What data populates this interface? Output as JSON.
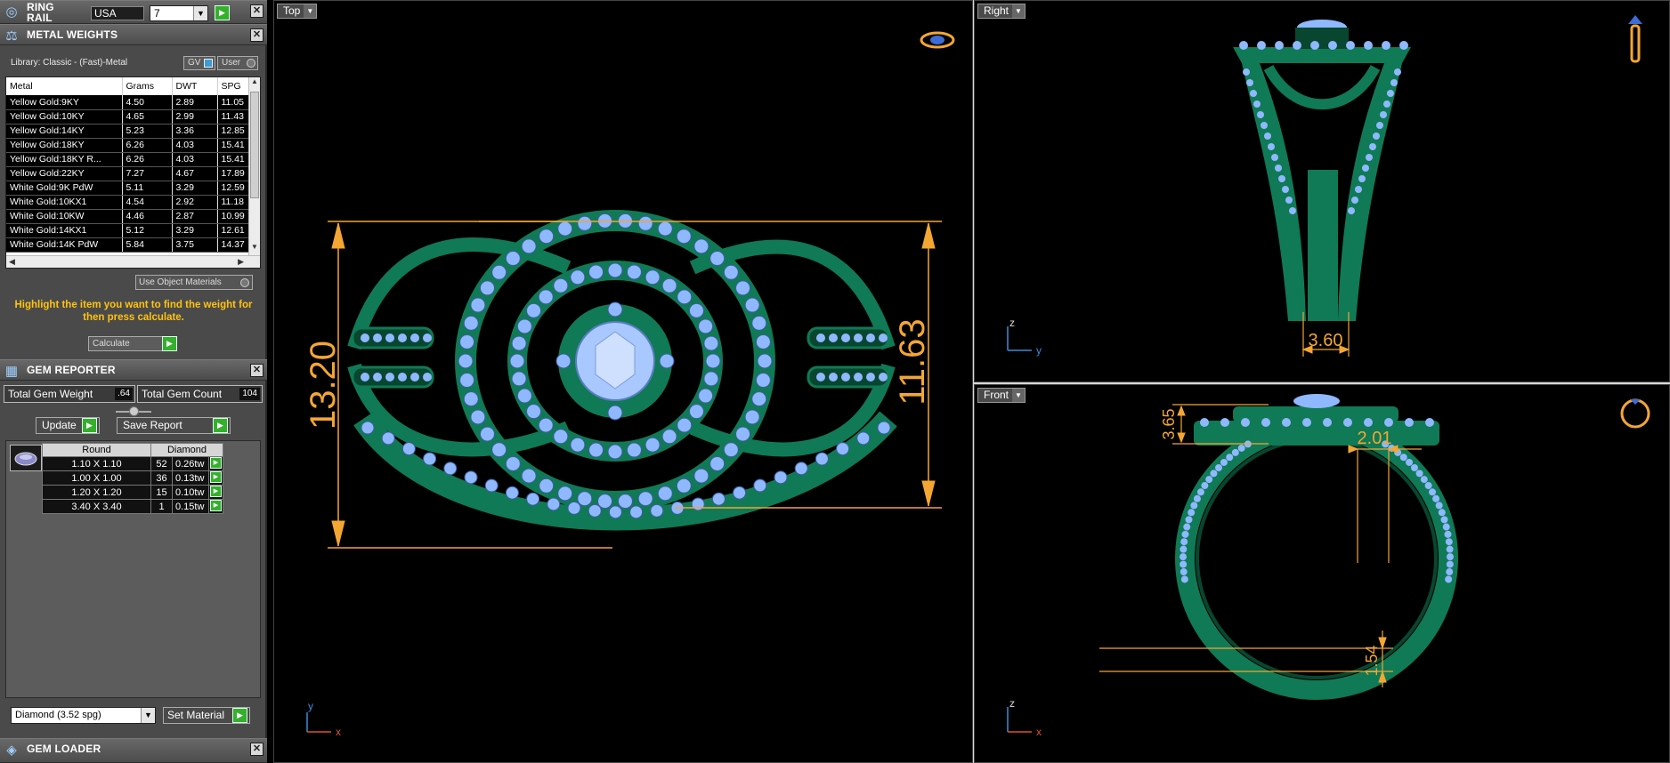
{
  "ring_rail": {
    "title": "RING RAIL",
    "country": "USA",
    "size": "7"
  },
  "metal_weights": {
    "title": "METAL WEIGHTS",
    "library": "Library: Classic - (Fast)-Metal",
    "gv_label": "GV",
    "user_label": "User",
    "columns": [
      "Metal",
      "Grams",
      "DWT",
      "SPG"
    ],
    "rows": [
      [
        "Yellow Gold:9KY",
        "4.50",
        "2.89",
        "11.05"
      ],
      [
        "Yellow Gold:10KY",
        "4.65",
        "2.99",
        "11.43"
      ],
      [
        "Yellow Gold:14KY",
        "5.23",
        "3.36",
        "12.85"
      ],
      [
        "Yellow Gold:18KY",
        "6.26",
        "4.03",
        "15.41"
      ],
      [
        "Yellow Gold:18KY R...",
        "6.26",
        "4.03",
        "15.41"
      ],
      [
        "Yellow Gold:22KY",
        "7.27",
        "4.67",
        "17.89"
      ],
      [
        "White Gold:9K PdW",
        "5.11",
        "3.29",
        "12.59"
      ],
      [
        "White Gold:10KX1",
        "4.54",
        "2.92",
        "11.18"
      ],
      [
        "White Gold:10KW",
        "4.46",
        "2.87",
        "10.99"
      ],
      [
        "White Gold:14KX1",
        "5.12",
        "3.29",
        "12.61"
      ],
      [
        "White Gold:14K PdW",
        "5.84",
        "3.75",
        "14.37"
      ]
    ],
    "use_object_materials": "Use Object Materials",
    "message": "Highlight the item you want to find the weight for then press calculate.",
    "calculate_label": "Calculate"
  },
  "gem_reporter": {
    "title": "GEM REPORTER",
    "total_weight_label": "Total Gem Weight",
    "total_weight_value": ".64",
    "total_count_label": "Total Gem Count",
    "total_count_value": "104",
    "update_label": "Update",
    "save_report_label": "Save Report",
    "col_shape": "Round",
    "col_stone": "Diamond",
    "gems": [
      {
        "size": "1.10 X 1.10",
        "count": "52",
        "tw": "0.26tw"
      },
      {
        "size": "1.00 X 1.00",
        "count": "36",
        "tw": "0.13tw"
      },
      {
        "size": "1.20 X 1.20",
        "count": "15",
        "tw": "0.10tw"
      },
      {
        "size": "3.40 X 3.40",
        "count": "1",
        "tw": "0.15tw"
      }
    ],
    "material_select": "Diamond     (3.52 spg)",
    "set_material_label": "Set Material"
  },
  "gem_loader": {
    "title": "GEM LOADER"
  },
  "viewports": {
    "top": {
      "label": "Top",
      "dim_height": "13.20",
      "dim_width": "11.63",
      "axis_y": "y",
      "axis_x": "x"
    },
    "right": {
      "label": "Right",
      "dim_shank": "3.60",
      "axis_z": "z",
      "axis_y": "y"
    },
    "front": {
      "label": "Front",
      "dim_top": "3.65",
      "dim_side": "2.01",
      "dim_bottom": "1.54",
      "axis_z": "z",
      "axis_x": "x"
    }
  },
  "colors": {
    "metal": "#0f7a55",
    "metal_dark": "#08462f",
    "gem": "#8fb8ff",
    "dimension": "#f4a633",
    "accent_button": "#35b02c",
    "highlight_text": "#ffc20e"
  }
}
